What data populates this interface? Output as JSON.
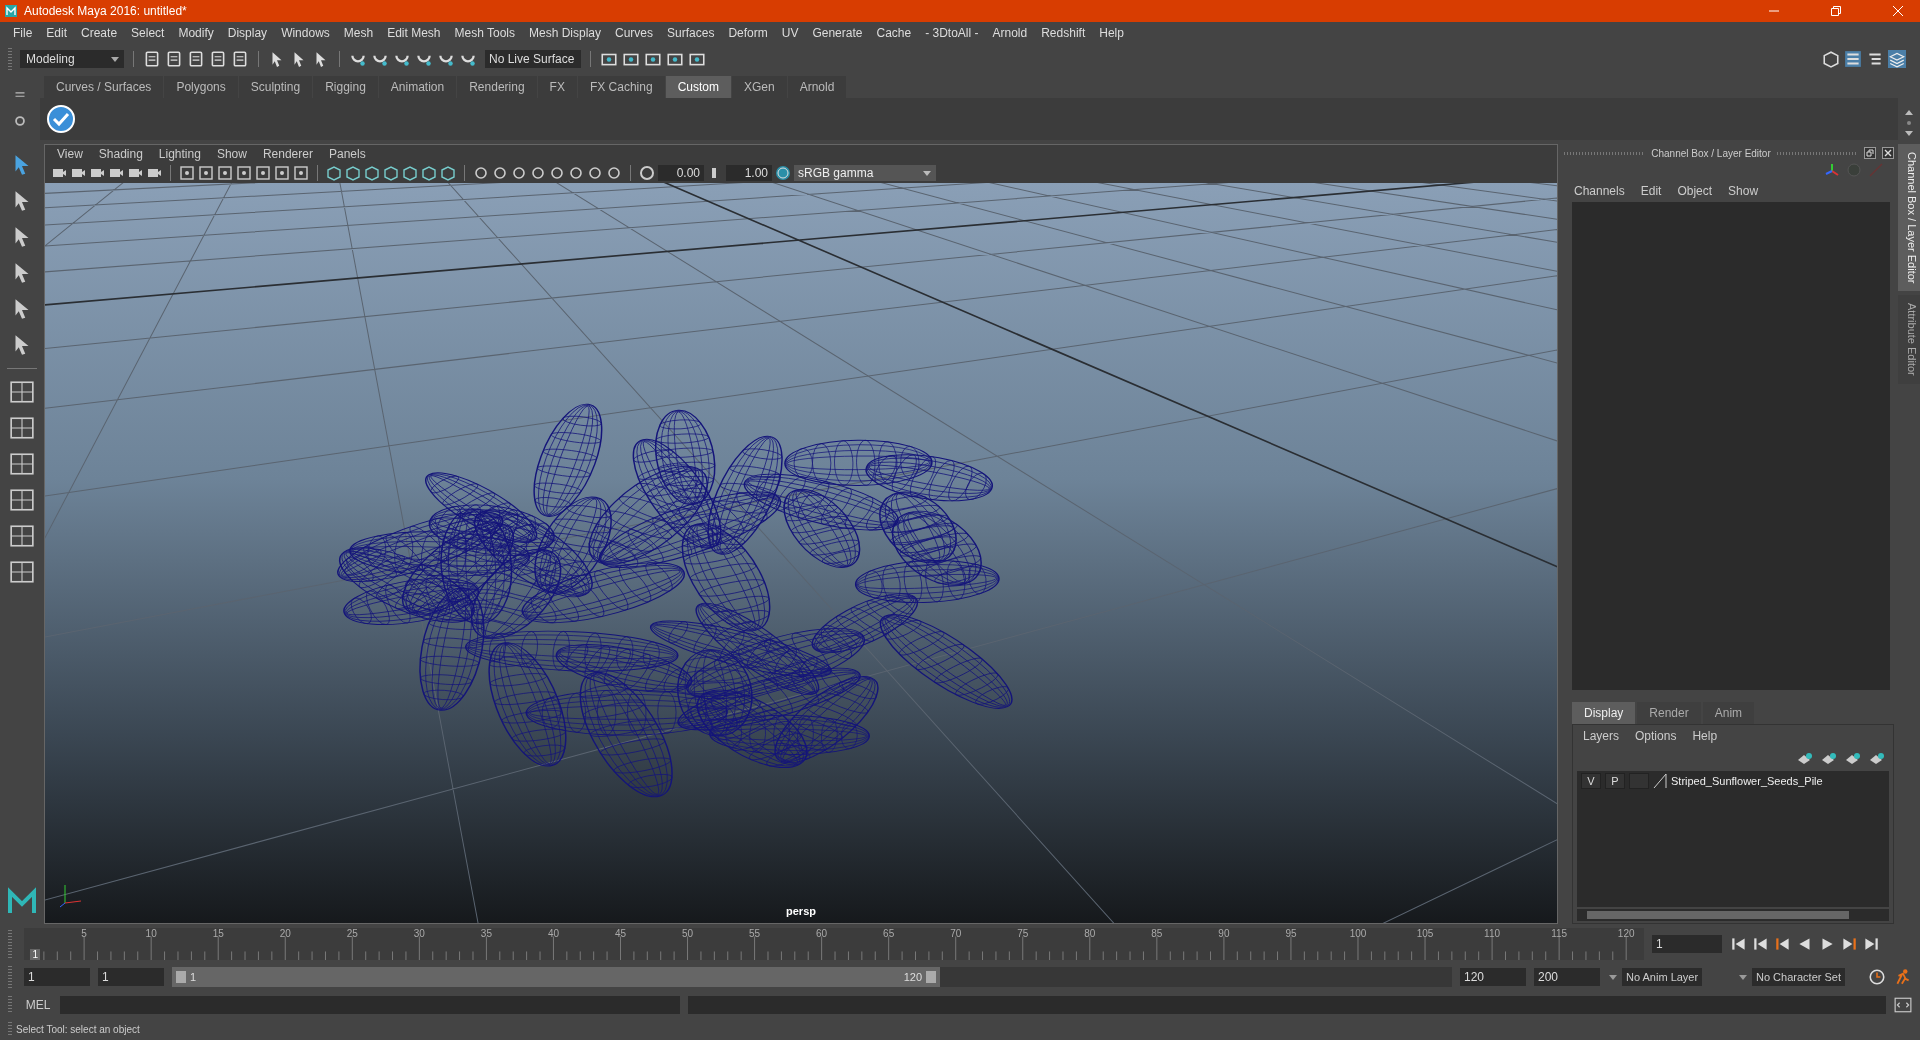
{
  "window": {
    "title": "Autodesk Maya 2016: untitled*"
  },
  "menu_bar": [
    "File",
    "Edit",
    "Create",
    "Select",
    "Modify",
    "Display",
    "Windows",
    "Mesh",
    "Edit Mesh",
    "Mesh Tools",
    "Mesh Display",
    "Curves",
    "Surfaces",
    "Deform",
    "UV",
    "Generate",
    "Cache",
    "- 3DtoAll -",
    "Arnold",
    "Redshift",
    "Help"
  ],
  "status_line": {
    "mode": "Modeling",
    "live_surface": "No Live Surface"
  },
  "shelf_tabs": [
    {
      "label": "Curves / Surfaces",
      "selected": false
    },
    {
      "label": "Polygons",
      "selected": false
    },
    {
      "label": "Sculpting",
      "selected": false
    },
    {
      "label": "Rigging",
      "selected": false
    },
    {
      "label": "Animation",
      "selected": false
    },
    {
      "label": "Rendering",
      "selected": false
    },
    {
      "label": "FX",
      "selected": false
    },
    {
      "label": "FX Caching",
      "selected": false
    },
    {
      "label": "Custom",
      "selected": true
    },
    {
      "label": "XGen",
      "selected": false
    },
    {
      "label": "Arnold",
      "selected": false
    }
  ],
  "viewport": {
    "menu": [
      "View",
      "Shading",
      "Lighting",
      "Show",
      "Renderer",
      "Panels"
    ],
    "exposure": "0.00",
    "gamma": "1.00",
    "color_space": "sRGB gamma",
    "camera": "persp"
  },
  "channel_box": {
    "title": "Channel Box / Layer Editor",
    "menu": [
      "Channels",
      "Edit",
      "Object",
      "Show"
    ],
    "tabs": [
      {
        "label": "Display",
        "selected": true
      },
      {
        "label": "Render",
        "selected": false
      },
      {
        "label": "Anim",
        "selected": false
      }
    ],
    "layer_menu": [
      "Layers",
      "Options",
      "Help"
    ],
    "layers": [
      {
        "visibility": "V",
        "playback": "P",
        "name": "Striped_Sunflower_Seeds_Pile"
      }
    ]
  },
  "side_tabs": [
    {
      "label": "Channel Box / Layer Editor",
      "selected": true
    },
    {
      "label": "Attribute Editor",
      "selected": false
    }
  ],
  "time_slider": {
    "start_mark": "1",
    "ticks": [
      "5",
      "10",
      "15",
      "20",
      "25",
      "30",
      "35",
      "40",
      "45",
      "50",
      "55",
      "60",
      "65",
      "70",
      "75",
      "80",
      "85",
      "90",
      "95",
      "100",
      "105",
      "110",
      "115",
      "120"
    ],
    "level": 0,
    "current_frame": "1"
  },
  "range_slider": {
    "start": "1",
    "playback_start": "1",
    "handle_start": "1",
    "handle_end": "120",
    "level": 0.6,
    "playback_end": "120",
    "end": "200",
    "anim_layer": "No Anim Layer",
    "character_set": "No Character Set"
  },
  "command_line": {
    "label": "MEL"
  },
  "help_line": "Select Tool: select an object"
}
